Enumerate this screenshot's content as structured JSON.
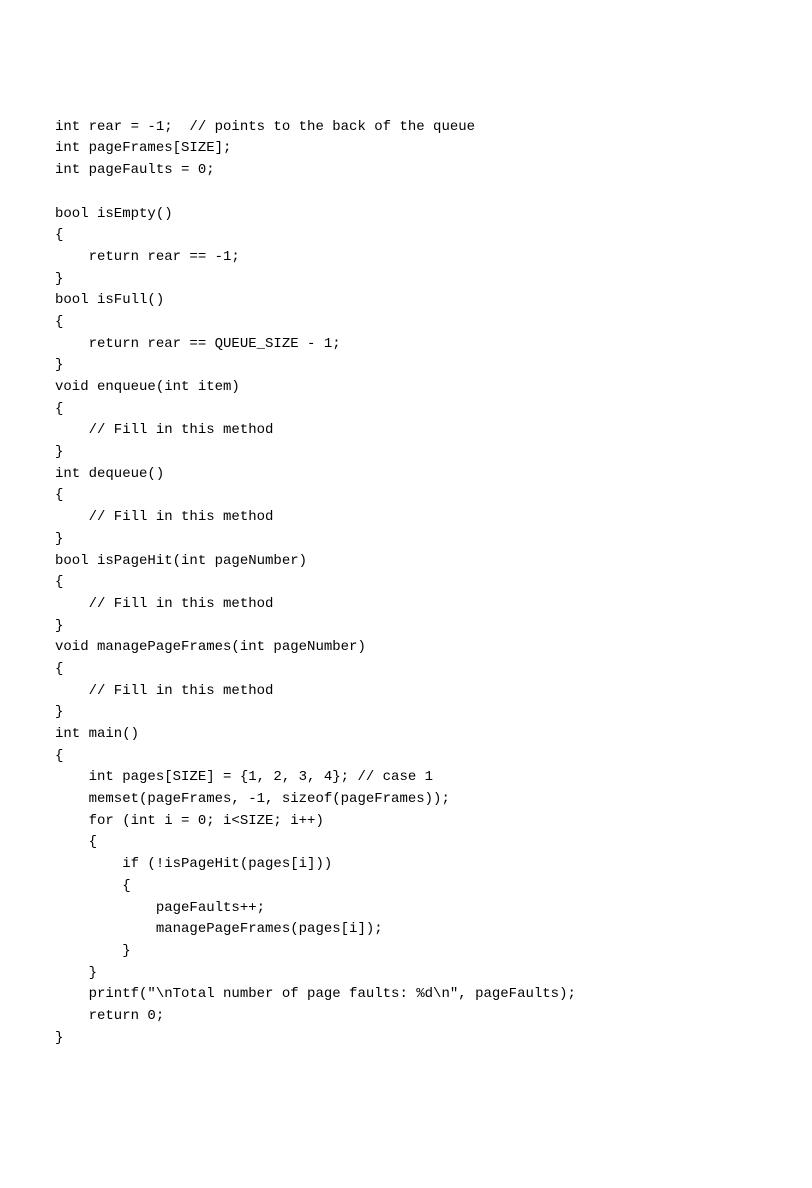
{
  "code": {
    "lines": [
      "int rear = -1;  // points to the back of the queue",
      "int pageFrames[SIZE];",
      "int pageFaults = 0;",
      "",
      "bool isEmpty()",
      "{",
      "    return rear == -1;",
      "}",
      "bool isFull()",
      "{",
      "    return rear == QUEUE_SIZE - 1;",
      "}",
      "void enqueue(int item)",
      "{",
      "    // Fill in this method",
      "}",
      "int dequeue()",
      "{",
      "    // Fill in this method",
      "}",
      "bool isPageHit(int pageNumber)",
      "{",
      "    // Fill in this method",
      "}",
      "void managePageFrames(int pageNumber)",
      "{",
      "    // Fill in this method",
      "}",
      "int main()",
      "{",
      "    int pages[SIZE] = {1, 2, 3, 4}; // case 1",
      "    memset(pageFrames, -1, sizeof(pageFrames));",
      "    for (int i = 0; i<SIZE; i++)",
      "    {",
      "        if (!isPageHit(pages[i]))",
      "        {",
      "            pageFaults++;",
      "            managePageFrames(pages[i]);",
      "        }",
      "    }",
      "    printf(\"\\nTotal number of page faults: %d\\n\", pageFaults);",
      "    return 0;",
      "}"
    ]
  }
}
